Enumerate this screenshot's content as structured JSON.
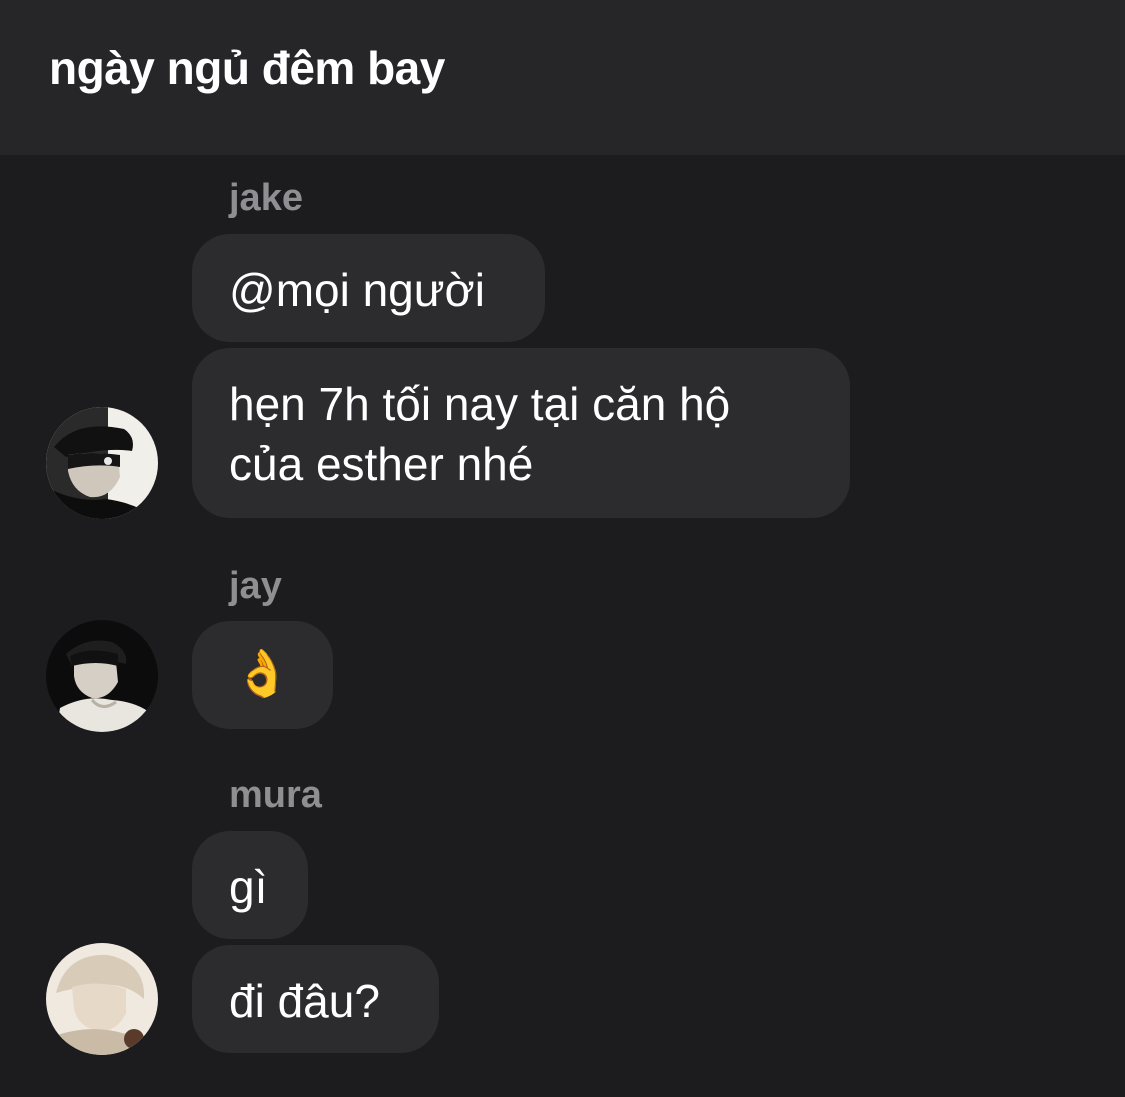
{
  "header": {
    "title": "ngày ngủ đêm bay"
  },
  "messages": [
    {
      "sender": "jake",
      "bubbles": [
        "@mọi người",
        "hẹn 7h tối nay tại căn hộ",
        "của esther nhé"
      ]
    },
    {
      "sender": "jay",
      "bubbles": [
        "👌"
      ]
    },
    {
      "sender": "mura",
      "bubbles": [
        "gì",
        "đi đâu?"
      ]
    }
  ],
  "colors": {
    "background": "#1c1c1e",
    "header": "#262628",
    "bubble": "#2c2c2e",
    "sender_name": "#8e8e93",
    "text": "#ffffff"
  }
}
